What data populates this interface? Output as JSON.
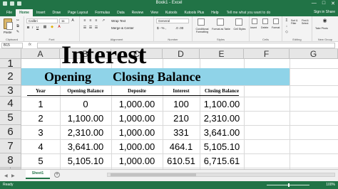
{
  "app": {
    "window_title": "Book1 - Excel",
    "window_controls": {
      "minimize": "—",
      "maximize": "□",
      "close": "✕"
    }
  },
  "ribbon_tabs": [
    {
      "label": "File"
    },
    {
      "label": "Home"
    },
    {
      "label": "Insert"
    },
    {
      "label": "Draw"
    },
    {
      "label": "Page Layout"
    },
    {
      "label": "Formulas"
    },
    {
      "label": "Data"
    },
    {
      "label": "Review"
    },
    {
      "label": "View"
    },
    {
      "label": "Kutools"
    },
    {
      "label": "Kutools Plus"
    },
    {
      "label": "Help"
    }
  ],
  "tell_me": "Tell me what you want to do",
  "account": "Sign in  Share",
  "ribbon": {
    "clipboard": {
      "label": "Clipboard",
      "paste": "Paste"
    },
    "font": {
      "label": "Font",
      "font_name": "Calibri",
      "font_size": "11",
      "bold": "B",
      "italic": "I",
      "underline": "U"
    },
    "alignment": {
      "label": "Alignment",
      "wrap_text": "Wrap Text",
      "merge_center": "Merge & Center"
    },
    "number": {
      "label": "Number",
      "format": "General",
      "currency": "$ - % ,",
      "decimals": ".0 .00"
    },
    "styles": {
      "label": "Styles",
      "conditional": "Conditional Formatting",
      "format_table": "Format as Table",
      "cell_styles": "Cell Styles"
    },
    "cells": {
      "label": "Cells",
      "insert": "Insert",
      "delete": "Delete",
      "format": "Format"
    },
    "editing": {
      "label": "Editing",
      "sort_filter": "Sort & Filter",
      "find_select": "Find & Select"
    },
    "new_group": {
      "label": "New Group",
      "take_photo": "Take Photo"
    }
  },
  "formula_bar": {
    "name_box": "B15",
    "fx": "fx",
    "content": ""
  },
  "columns": [
    "A",
    "B",
    "C",
    "D",
    "E",
    "F",
    "G"
  ],
  "rows": [
    "1",
    "2",
    "3",
    "4",
    "5",
    "6",
    "7",
    "8",
    "9"
  ],
  "sheet": {
    "title": "Interest",
    "subtitle_left": "Opening",
    "subtitle_right": "Closing Balance",
    "headers": [
      "Year",
      "Opening Balance",
      "Deposite",
      "Interest",
      "Closing Balance"
    ],
    "data": [
      [
        "1",
        "0",
        "1,000.00",
        "100",
        "1,100.00"
      ],
      [
        "2",
        "1,100.00",
        "1,000.00",
        "210",
        "2,310.00"
      ],
      [
        "3",
        "2,310.00",
        "1,000.00",
        "331",
        "3,641.00"
      ],
      [
        "4",
        "3,641.00",
        "1,000.00",
        "464.1",
        "5,105.10"
      ],
      [
        "5",
        "5,105.10",
        "1,000.00",
        "610.51",
        "6,715.61"
      ]
    ]
  },
  "sheet_tabs": [
    {
      "label": "Sheet1"
    }
  ],
  "add_sheet": "+",
  "status": {
    "ready": "Ready",
    "zoom": "100%"
  },
  "colors": {
    "excel_green": "#217346",
    "banner": "#8fd3e8"
  }
}
